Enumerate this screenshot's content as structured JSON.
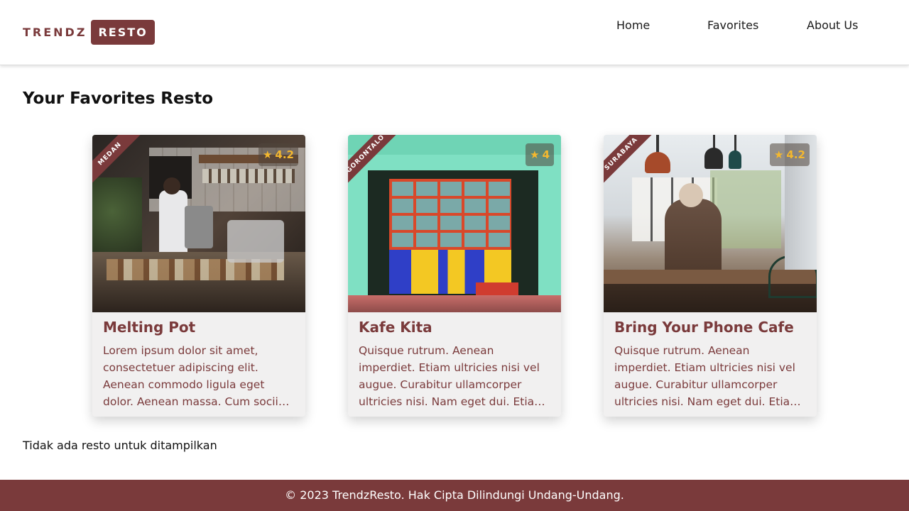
{
  "brand": {
    "part1": "TRENDZ",
    "part2": "RESTO",
    "color": "#7a3a3b"
  },
  "nav": {
    "home": "Home",
    "favorites": "Favorites",
    "about": "About Us"
  },
  "page": {
    "title": "Your Favorites Resto",
    "empty_message": "Tidak ada resto untuk ditampilkan"
  },
  "restaurants": [
    {
      "name": "Melting Pot",
      "city": "MEDAN",
      "rating": "4.2",
      "description": "Lorem ipsum dolor sit amet, consectetuer adipiscing elit. Aenean commodo ligula eget dolor. Aenean massa. Cum sociis natoque penatibus et"
    },
    {
      "name": "Kafe Kita",
      "city": "GORONTALO",
      "rating": "4",
      "description": "Quisque rutrum. Aenean imperdiet. Etiam ultricies nisi vel augue. Curabitur ullamcorper ultricies nisi. Nam eget dui. Etiam rhoncus."
    },
    {
      "name": "Bring Your Phone Cafe",
      "city": "SURABAYA",
      "rating": "4.2",
      "description": "Quisque rutrum. Aenean imperdiet. Etiam ultricies nisi vel augue. Curabitur ullamcorper ultricies nisi. Nam eget dui. Etiam rhoncus."
    }
  ],
  "footer": {
    "text": "© 2023 TrendzResto. Hak Cipta Dilindungi Undang-Undang."
  },
  "icons": {
    "rating": "star-icon"
  },
  "colors": {
    "accent": "#7a3a3b",
    "rating": "#f5b82e",
    "card_bg": "#f1f0f0"
  }
}
